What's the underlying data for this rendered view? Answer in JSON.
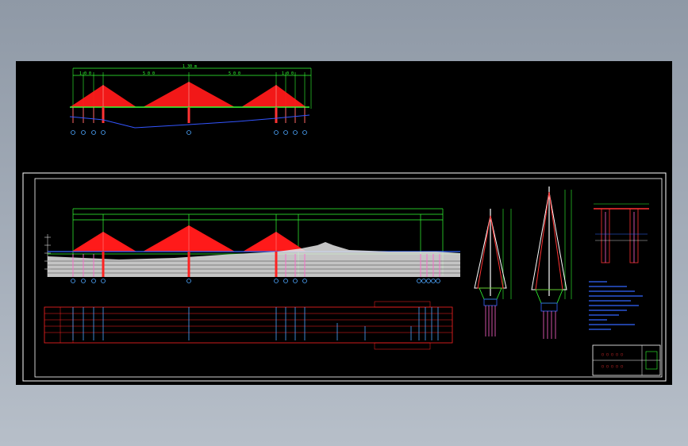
{
  "drawing": {
    "top_overall_dim": "1 30 m",
    "top_span_main_left": "5 0 0",
    "top_span_main_right": "5 0 0",
    "top_span_side_left": "1 0 0",
    "top_span_side_right": "1 0 0",
    "title_block_row1": "○ ○ ○ ○ ○",
    "title_block_row2": "○ ○ ○ ○ ○"
  },
  "colors": {
    "background": "#000000",
    "cables": "#ff1a1a",
    "dimensions": "#33ff33",
    "pylons": "#ff3333",
    "frame": "#ffffff",
    "notes": "#3366ff",
    "axis_markers": "#4da6ff",
    "profile_table": "#ff2222"
  }
}
